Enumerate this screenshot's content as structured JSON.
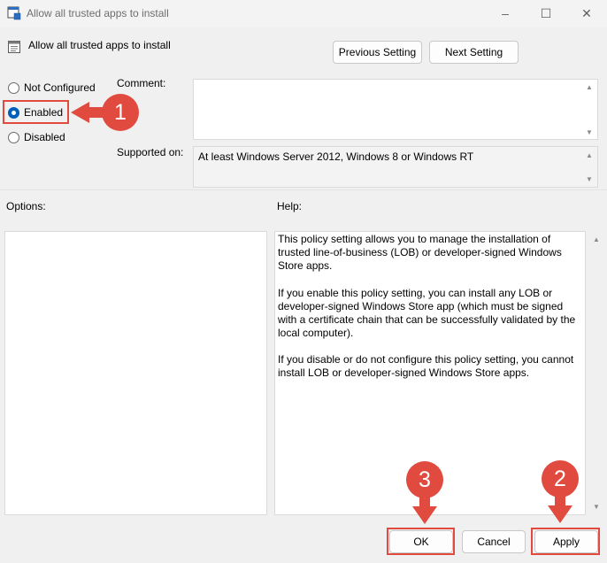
{
  "window": {
    "title": "Allow all trusted apps to install",
    "controls": {
      "minimize": "–",
      "maximize": "☐",
      "close": "✕"
    }
  },
  "header": {
    "policy_name": "Allow all trusted apps to install",
    "prev_label": "Previous Setting",
    "next_label": "Next Setting"
  },
  "state": {
    "options": [
      {
        "label": "Not Configured",
        "checked": false
      },
      {
        "label": "Enabled",
        "checked": true
      },
      {
        "label": "Disabled",
        "checked": false
      }
    ]
  },
  "comment": {
    "label": "Comment:",
    "value": ""
  },
  "supported": {
    "label": "Supported on:",
    "value": "At least Windows Server 2012, Windows 8 or Windows RT"
  },
  "options_section": {
    "label": "Options:"
  },
  "help_section": {
    "label": "Help:",
    "paragraphs": [
      "This policy setting allows you to manage the installation of trusted line-of-business (LOB) or developer-signed Windows Store apps.",
      "If you enable this policy setting, you can install any LOB or developer-signed Windows Store app (which must be signed with a certificate chain that can be successfully validated by the local computer).",
      "If you disable or do not configure this policy setting, you cannot install LOB or developer-signed Windows Store apps."
    ]
  },
  "footer": {
    "ok_label": "OK",
    "cancel_label": "Cancel",
    "apply_label": "Apply"
  },
  "annotations": {
    "step1": "1",
    "step2": "2",
    "step3": "3",
    "color": "#e04a3f"
  },
  "colors": {
    "accent": "#005fb8",
    "highlight": "#e04a3f",
    "background": "#f0f0f0"
  }
}
